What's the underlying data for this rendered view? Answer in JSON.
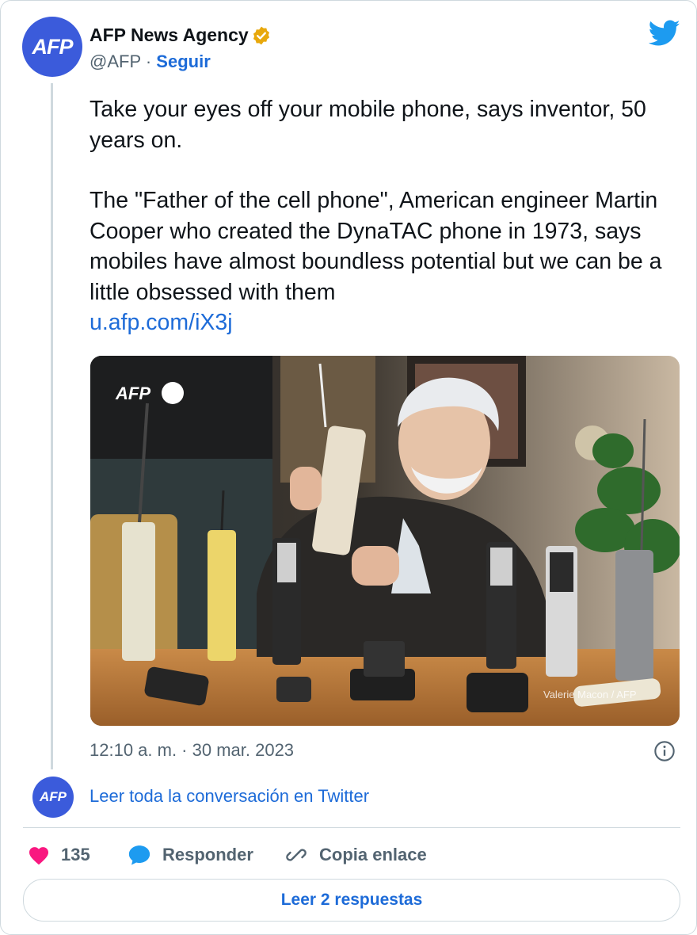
{
  "author": {
    "avatar_text": "AFP",
    "name": "AFP News Agency",
    "handle": "@AFP",
    "separator": " · ",
    "follow_label": "Seguir"
  },
  "tweet": {
    "line1": "Take your eyes off your mobile phone, says inventor, 50 years on.",
    "line2": "The \"Father of the cell phone\", American engineer Martin Cooper who created the DynaTAC phone in 1973, says mobiles have almost boundless potential but we can be a little obsessed with them",
    "link": "u.afp.com/iX3j"
  },
  "photo": {
    "watermark": "AFP",
    "credit": "Valerie Macon / AFP"
  },
  "timestamp": "12:10 a. m. · 30 mar. 2023",
  "conversation": {
    "avatar_text": "AFP",
    "label": "Leer toda la conversación en Twitter"
  },
  "actions": {
    "likes": "135",
    "reply_label": "Responder",
    "copy_label": "Copia enlace"
  },
  "replies_button": "Leer 2 respuestas",
  "colors": {
    "accent": "#1d6bd8",
    "avatar": "#3b5bdb",
    "like": "#f91880",
    "twitter": "#1d9bf0"
  }
}
